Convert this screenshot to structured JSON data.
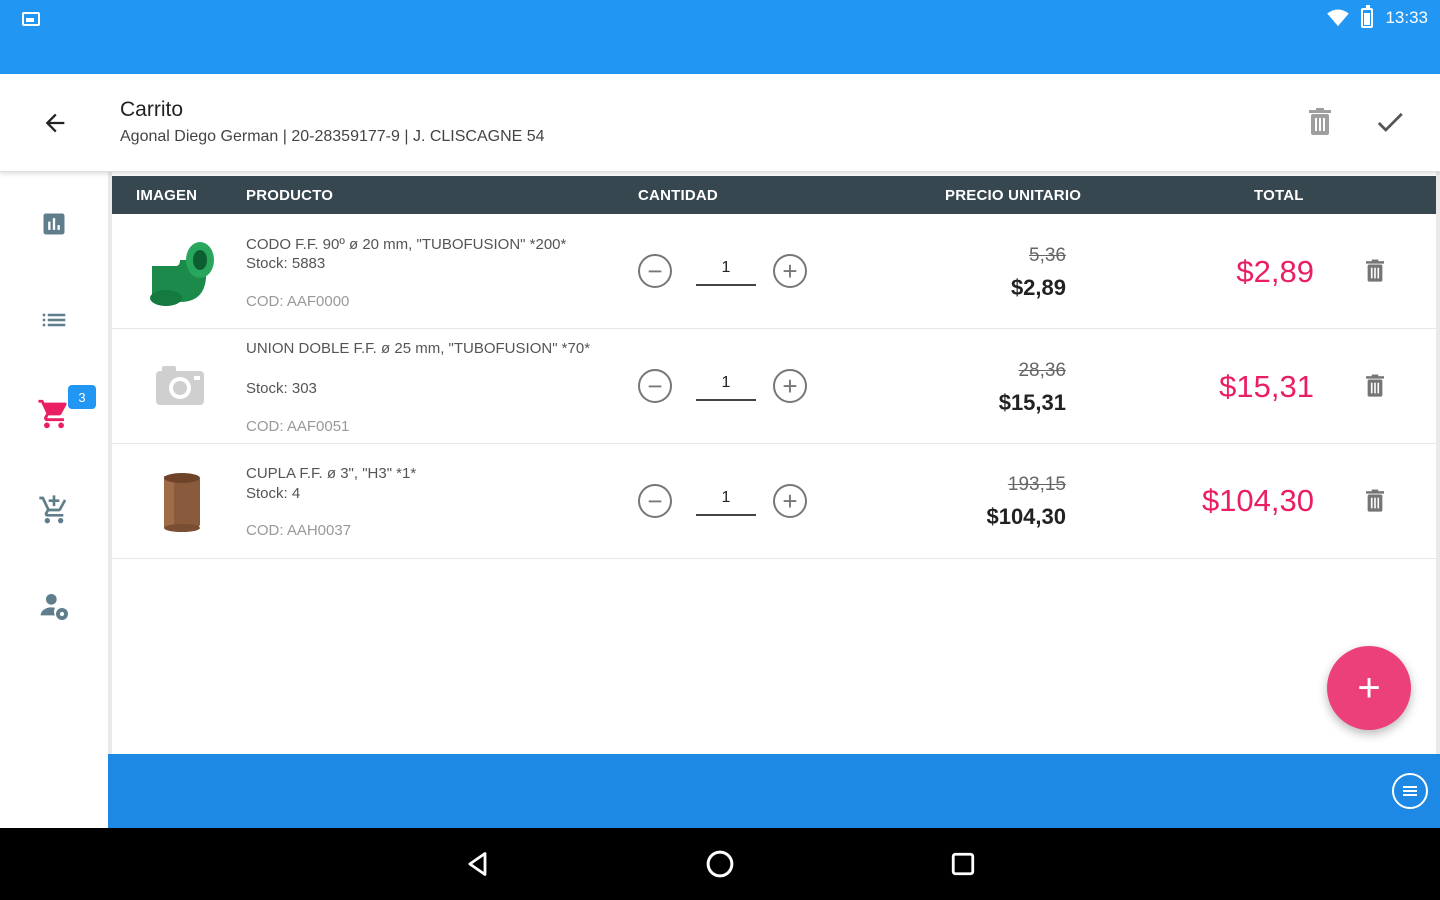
{
  "status_bar": {
    "time": "13:33"
  },
  "app_bar": {
    "title": "Carrito",
    "subtitle": "Agonal Diego German  | 20-28359177-9 | J. CLISCAGNE 54"
  },
  "side_nav": {
    "items": [
      {
        "icon": "bar-chart-icon"
      },
      {
        "icon": "list-icon"
      },
      {
        "icon": "cart-icon",
        "badge": "3",
        "active": true
      },
      {
        "icon": "cart-add-icon"
      },
      {
        "icon": "person-settings-icon"
      }
    ],
    "active_color": "#E91E63"
  },
  "table": {
    "headers": {
      "image": "IMAGEN",
      "product": "PRODUCTO",
      "quantity": "CANTIDAD",
      "unit_price": "PRECIO UNITARIO",
      "total": "TOTAL"
    },
    "rows": [
      {
        "name": "CODO F.F. 90º ø 20 mm, \"TUBOFUSION\"  *200*",
        "stock": "Stock: 5883",
        "code": "COD: AAF0000",
        "quantity": "1",
        "old_price": "5,36",
        "price": "$2,89",
        "total": "$2,89",
        "thumb": "green-elbow"
      },
      {
        "name": "UNION DOBLE F.F. ø 25 mm, \"TUBOFUSION\" *70*",
        "stock": "Stock: 303",
        "code": "COD: AAF0051",
        "quantity": "1",
        "old_price": "28,36",
        "price": "$15,31",
        "total": "$15,31",
        "thumb": "camera-placeholder"
      },
      {
        "name": "CUPLA F.F. ø 3\", \"H3\"  *1*",
        "stock": "Stock: 4",
        "code": "COD: AAH0037",
        "quantity": "1",
        "old_price": "193,15",
        "price": "$104,30",
        "total": "$104,30",
        "thumb": "brown-coupling"
      }
    ]
  },
  "fab": {
    "label": "+"
  },
  "colors": {
    "status_bar": "#2196F3",
    "table_header": "#37474F",
    "accent": "#E91E63",
    "fab": "#EC407A",
    "bottom_bar": "#1E88E5"
  }
}
